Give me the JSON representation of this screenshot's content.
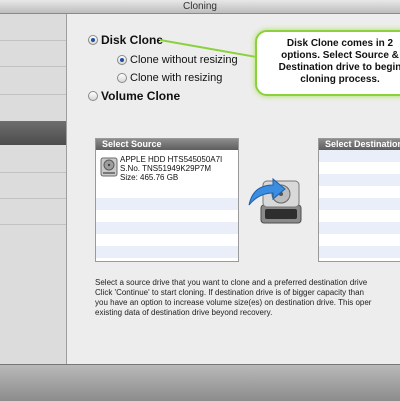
{
  "window": {
    "title": "Cloning"
  },
  "clone_options": {
    "disk_clone": {
      "label": "Disk Clone",
      "selected": true
    },
    "without_resizing": {
      "label": "Clone without resizing",
      "selected": true
    },
    "with_resizing": {
      "label": "Clone with resizing",
      "selected": false
    },
    "volume_clone": {
      "label": "Volume Clone",
      "selected": false
    }
  },
  "callout": {
    "lines": [
      "Disk Clone comes in 2",
      "options. Select Source &",
      "Destination drive to begin",
      "cloning process."
    ]
  },
  "source": {
    "header": "Select Source",
    "drive": {
      "name": "APPLE HDD HTS545050A7I",
      "serial": "S.No. TNS51949K29P7M",
      "size": "Size: 465.76 GB",
      "icon": "hard-drive-icon"
    }
  },
  "destination": {
    "header": "Select Destination"
  },
  "clone_icon": "clone-arrow-drive-icon",
  "description": {
    "lines": [
      "Select a source drive that you want to clone and a preferred destination drive",
      "Click 'Continue' to start cloning. If destination drive is of bigger capacity than",
      "you have an option to increase volume size(es) on destination drive. This oper",
      "existing data of destination drive beyond recovery."
    ]
  },
  "colors": {
    "callout_border": "#8bd13e",
    "panel_header": "#6e6e6e",
    "radio_selected": "#1f4ea3"
  }
}
